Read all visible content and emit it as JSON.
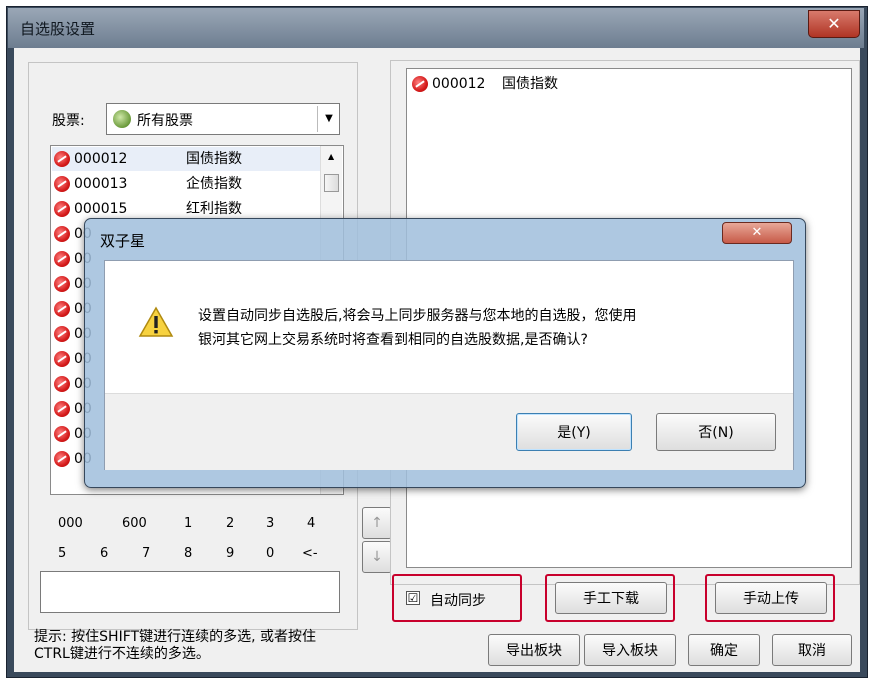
{
  "window": {
    "title": "自选股设置",
    "close_glyph": "✕"
  },
  "left_panel": {
    "stock_label": "股票:",
    "stock_select": "所有股票",
    "stocks": [
      {
        "code": "000012",
        "name": "国债指数"
      },
      {
        "code": "000013",
        "name": "企债指数"
      },
      {
        "code": "000015",
        "name": "红利指数"
      },
      {
        "code": "00",
        "name": ""
      },
      {
        "code": "00",
        "name": ""
      },
      {
        "code": "00",
        "name": ""
      },
      {
        "code": "00",
        "name": ""
      },
      {
        "code": "00",
        "name": ""
      },
      {
        "code": "00",
        "name": ""
      },
      {
        "code": "00",
        "name": ""
      },
      {
        "code": "00",
        "name": ""
      },
      {
        "code": "00",
        "name": ""
      },
      {
        "code": "00",
        "name": ""
      }
    ],
    "keypad_row1": [
      "000",
      "600",
      "1",
      "2",
      "3",
      "4"
    ],
    "keypad_row2": [
      "5",
      "6",
      "7",
      "8",
      "9",
      "0",
      "<-"
    ],
    "input_value": "",
    "hint_line1": "提示: 按住SHIFT键进行连续的多选, 或者按住",
    "hint_line2": "CTRL键进行不连续的多选。"
  },
  "right_panel": {
    "selected": [
      {
        "code": "000012",
        "name": "国债指数"
      }
    ]
  },
  "middle": {
    "up_arrow": "↑",
    "down_arrow": "↓"
  },
  "sync": {
    "checkbox_glyph": "☑",
    "label": "自动同步",
    "checked": true
  },
  "buttons": {
    "manual_download": "手工下载",
    "manual_upload": "手动上传",
    "export": "导出板块",
    "import": "导入板块",
    "ok": "确定",
    "cancel": "取消"
  },
  "dialog": {
    "title": "双子星",
    "message_line1": "设置自动同步自选股后,将会马上同步服务器与您本地的自选股，您使用",
    "message_line2": "银河其它网上交易系统时将查看到相同的自选股数据,是否确认?",
    "yes": "是(Y)",
    "no": "否(N)",
    "close_glyph": "✕"
  },
  "colors": {
    "highlight": "#c8002c",
    "dialog_frame": "#a0bedc"
  }
}
